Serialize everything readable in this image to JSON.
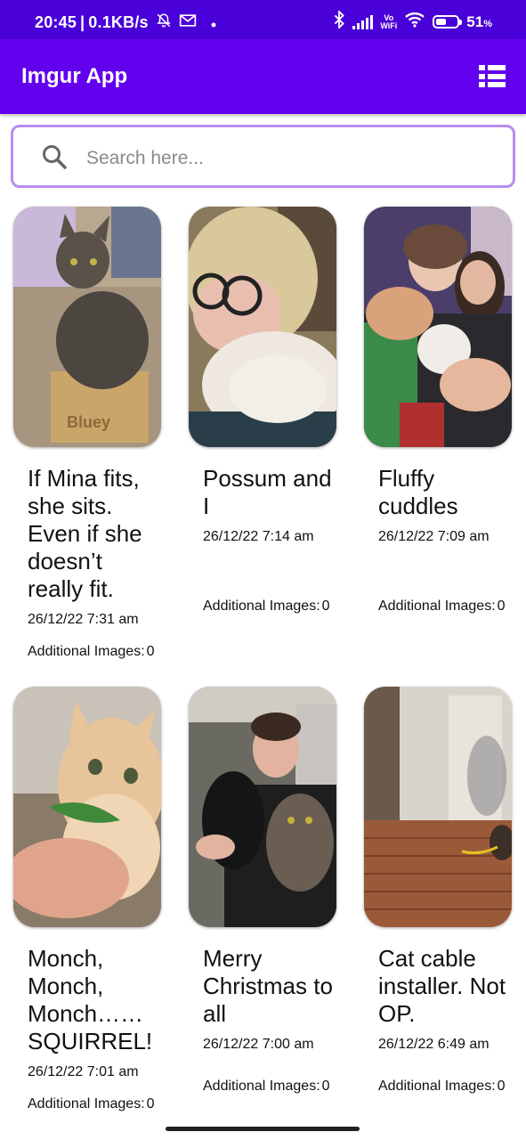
{
  "status_bar": {
    "time": "20:45",
    "speed": "0.1KB/s",
    "volte_top": "Vo",
    "volte_bottom": "WiFi",
    "battery_pct": "51",
    "battery_unit": "%",
    "battery_level": 0.51
  },
  "app_bar": {
    "title": "Imgur App",
    "toggle_icon": "view-list-icon"
  },
  "search": {
    "placeholder": "Search here...",
    "value": ""
  },
  "posts": [
    {
      "title": "If Mina fits, she sits. Even if she doesn’t really fit.",
      "date": "26/12/22 7:31 am",
      "additional_label": "Additional Images:",
      "additional_count": "0",
      "image": "tabby-cat-in-box"
    },
    {
      "title": "Possum and I",
      "date": "26/12/22 7:14 am",
      "additional_label": "Additional Images:",
      "additional_count": "0",
      "image": "woman-with-white-cat"
    },
    {
      "title": "Fluffy cuddles",
      "date": "26/12/22 7:09 am",
      "additional_label": "Additional Images:",
      "additional_count": "0",
      "image": "couple-holding-cats"
    },
    {
      "title": "Monch, Monch, Monch…… SQUIRREL!",
      "date": "26/12/22 7:01 am",
      "additional_label": "Additional Images:",
      "additional_count": "0",
      "image": "orange-cat-eating-leaf"
    },
    {
      "title": "Merry Christmas to all",
      "date": "26/12/22 7:00 am",
      "additional_label": "Additional Images:",
      "additional_count": "0",
      "image": "man-holding-two-cats"
    },
    {
      "title": "Cat cable installer. Not OP.",
      "date": "26/12/22 6:49 am",
      "additional_label": "Additional Images:",
      "additional_count": "0",
      "image": "deck-with-cat"
    }
  ],
  "colors": {
    "status_bar": "#4a00d8",
    "app_bar": "#6200ee",
    "search_border": "#b78df0"
  }
}
